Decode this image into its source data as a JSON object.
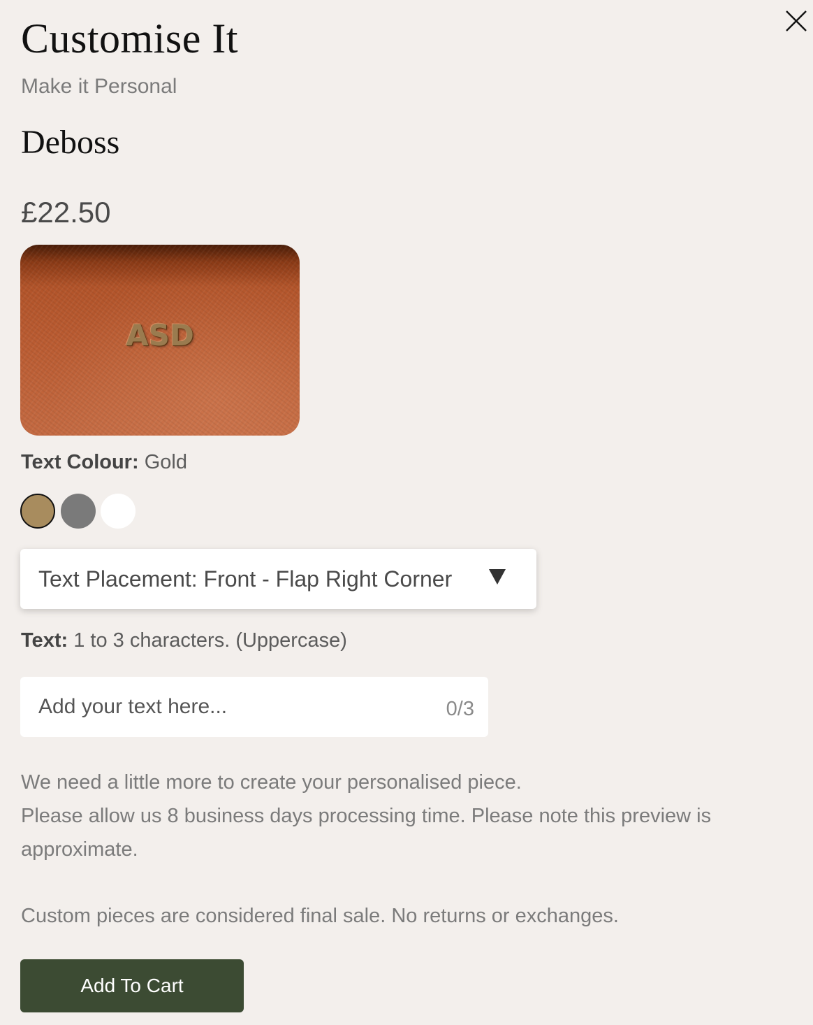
{
  "header": {
    "title": "Customise It",
    "subtitle": "Make it Personal",
    "close_icon": "close-icon"
  },
  "option": {
    "name": "Deboss",
    "price": "£22.50"
  },
  "preview": {
    "text": "ASD",
    "leather_color": "#b85a2f",
    "text_color": "#9a7b4f"
  },
  "text_colour": {
    "label": "Text Colour:",
    "value": "Gold",
    "swatches": [
      {
        "name": "Gold",
        "color": "#a88c5e",
        "selected": true
      },
      {
        "name": "Grey",
        "color": "#7a7a7a",
        "selected": false
      },
      {
        "name": "White",
        "color": "#ffffff",
        "selected": false
      }
    ]
  },
  "placement": {
    "label": "Text Placement: Front - Flap Right Corner",
    "icon": "triangle-down-icon"
  },
  "text": {
    "label": "Text:",
    "hint": "1 to 3 characters. (Uppercase)",
    "placeholder": "Add your text here...",
    "value": "",
    "counter": "0/3"
  },
  "notes": {
    "line1": "We need a little more to create your personalised piece.",
    "line2": "Please allow us 8 business days processing time. Please note this preview is approximate.",
    "final_sale": "Custom pieces are considered final sale. No returns or exchanges."
  },
  "cta": {
    "label": "Add To Cart",
    "color": "#3c4b33"
  }
}
